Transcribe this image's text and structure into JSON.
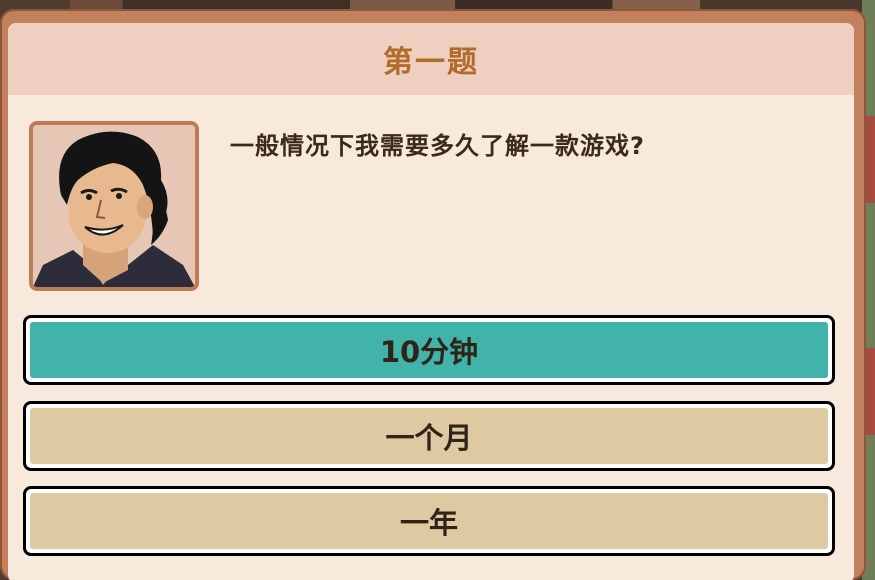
{
  "dialog": {
    "title": "第一题",
    "question": "一般情况下我需要多久了解一款游戏?",
    "portrait": "man-portrait"
  },
  "options": [
    {
      "label": "10分钟",
      "selected": true
    },
    {
      "label": "一个月",
      "selected": false
    },
    {
      "label": "一年",
      "selected": false
    }
  ],
  "colors": {
    "frame": "#c2805c",
    "panel": "#f7e9dc",
    "title_bar": "#efd0c0",
    "title_text": "#b06c2a",
    "option_selected": "#41b3a9",
    "option_normal": "#decaa2"
  }
}
